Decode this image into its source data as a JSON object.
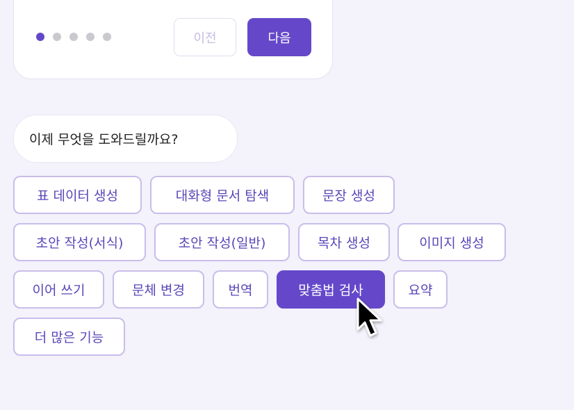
{
  "card": {
    "pager_dots": [
      {
        "active": true
      },
      {
        "active": false
      },
      {
        "active": false
      },
      {
        "active": false
      },
      {
        "active": false
      }
    ],
    "prev_label": "이전",
    "next_label": "다음"
  },
  "prompt": {
    "text": "이제 무엇을 도와드릴까요?"
  },
  "chips": [
    {
      "label": "표 데이터 생성"
    },
    {
      "label": "대화형 문서 탐색"
    },
    {
      "label": "문장 생성"
    },
    {
      "label": "초안 작성(서식)"
    },
    {
      "label": "초안 작성(일반)"
    },
    {
      "label": "목차 생성"
    },
    {
      "label": "이미지 생성"
    },
    {
      "label": "이어 쓰기"
    },
    {
      "label": "문체 변경"
    },
    {
      "label": "번역"
    },
    {
      "label": "맞춤법 검사",
      "selected": true
    },
    {
      "label": "요약"
    },
    {
      "label": "더 많은 기능"
    }
  ],
  "colors": {
    "accent": "#6548c9",
    "background": "#f4f2fa",
    "chip_border": "#c9bdeb",
    "chip_text": "#5a46b8"
  },
  "icons": {
    "cursor": "mouse-pointer-icon"
  }
}
